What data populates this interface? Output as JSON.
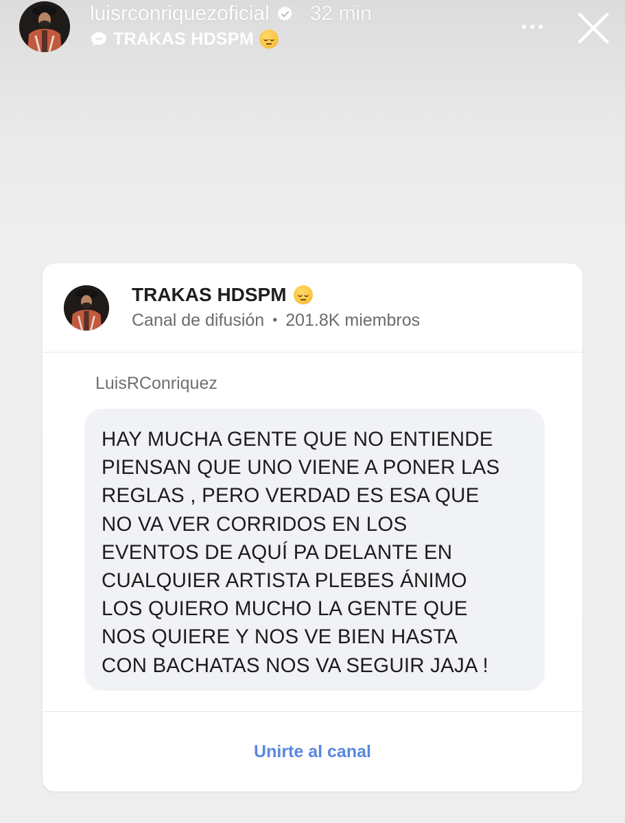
{
  "story": {
    "username": "luisrconriquezoficial",
    "time": "32 min",
    "subtitle": "TRAKAS HDSPM",
    "verified": true,
    "icons": {
      "avatar": "avatar",
      "verified": "verified-badge-icon",
      "subtitle_icon": "chat-bubble-icon",
      "subtitle_emoji": "pensive-face-emoji",
      "more": "more-dots-icon",
      "close": "close-icon"
    }
  },
  "card": {
    "channel_name": "TRAKAS HDSPM",
    "channel_type": "Canal de difusión",
    "separator": "•",
    "members": "201.8K miembros",
    "sender": "LuisRConriquez",
    "message": "HAY MUCHA GENTE QUE NO ENTIENDE\nPIENSAN QUE UNO VIENE A PONER LAS\nREGLAS , PERO VERDAD ES ESA QUE\nNO VA VER CORRIDOS EN LOS\nEVENTOS DE AQUÍ PA DELANTE EN\nCUALQUIER ARTISTA PLEBES ÁNIMO\nLOS QUIERO MUCHO LA GENTE QUE\nNOS QUIERE Y NOS VE BIEN HASTA\nCON BACHATAS NOS VA SEGUIR JAJA !",
    "join_label": "Unirte al canal"
  },
  "colors": {
    "accent": "#5a86e0",
    "bubble": "#f1f2f5",
    "verified": "#3897f0",
    "avatar_shirt": "#c2593e"
  }
}
